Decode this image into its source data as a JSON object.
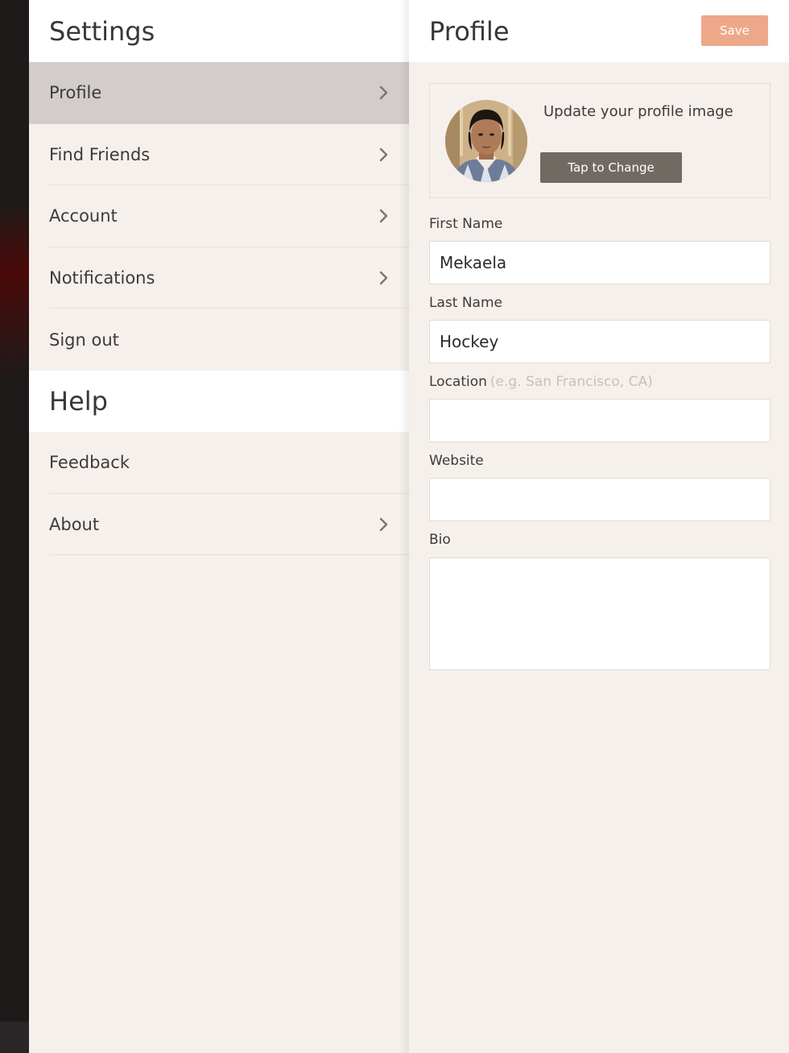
{
  "settings": {
    "title": "Settings",
    "items": [
      {
        "label": "Profile",
        "chevron": true,
        "active": true
      },
      {
        "label": "Find Friends",
        "chevron": true
      },
      {
        "label": "Account",
        "chevron": true
      },
      {
        "label": "Notifications",
        "chevron": true
      },
      {
        "label": "Sign out",
        "chevron": false
      }
    ],
    "help_title": "Help",
    "help_items": [
      {
        "label": "Feedback",
        "chevron": false
      },
      {
        "label": "About",
        "chevron": true
      }
    ]
  },
  "profile": {
    "title": "Profile",
    "save_label": "Save",
    "image_prompt": "Update your profile image",
    "change_label": "Tap to Change",
    "fields": {
      "first_name": {
        "label": "First Name",
        "value": "Mekaela"
      },
      "last_name": {
        "label": "Last Name",
        "value": "Hockey"
      },
      "location": {
        "label": "Location",
        "hint": "(e.g. San Francisco, CA)",
        "value": ""
      },
      "website": {
        "label": "Website",
        "value": ""
      },
      "bio": {
        "label": "Bio",
        "value": ""
      }
    }
  },
  "icons": {
    "chevron": "chevron-right-icon",
    "avatar": "profile-photo"
  },
  "colors": {
    "panel_bg": "#f5f0eb",
    "active_row": "#d2cdcb",
    "save_accent": "#eda88a",
    "change_button": "#716a63"
  }
}
